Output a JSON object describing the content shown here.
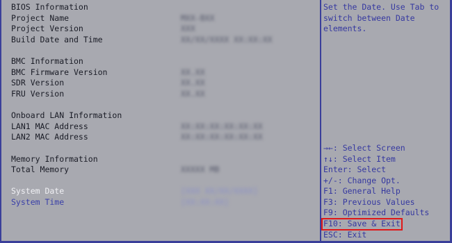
{
  "bios": {
    "section_title": "BIOS Information",
    "project_name_label": "Project Name",
    "project_name_value": "MXX-BXX",
    "project_version_label": "Project Version",
    "project_version_value": "XXX",
    "build_date_label": "Build Date and Time",
    "build_date_value": "XX/XX/XXXX XX:XX:XX"
  },
  "bmc": {
    "section_title": "BMC Information",
    "firmware_label": "BMC Firmware Version",
    "firmware_value": "XX.XX",
    "sdr_label": "SDR Version",
    "sdr_value": "XX.XX",
    "fru_label": "FRU Version",
    "fru_value": "XX.XX"
  },
  "lan": {
    "section_title": "Onboard LAN Information",
    "lan1_label": "LAN1 MAC Address",
    "lan1_value": "XX:XX:XX:XX:XX:XX",
    "lan2_label": "LAN2 MAC Address",
    "lan2_value": "XX:XX:XX:XX:XX:XX"
  },
  "memory": {
    "section_title": "Memory Information",
    "total_label": "Total Memory",
    "total_value": "XXXXX MB"
  },
  "system": {
    "date_label": "System Date",
    "date_value": "[XXX XX/XX/XXXX]",
    "time_label": "System Time",
    "time_value": "[XX:XX:XX]"
  },
  "help": {
    "text": "Set the Date. Use Tab to\nswitch between Date\nelements."
  },
  "hotkeys": [
    "→←: Select Screen",
    "↑↓: Select Item",
    "Enter: Select",
    "+/-: Change Opt.",
    "F1: General Help",
    "F3: Previous Values",
    "F9: Optimized Defaults",
    "F10: Save & Exit",
    "ESC: Exit"
  ],
  "colors": {
    "background": "#a8a9b0",
    "frame": "#3a3f9a",
    "help_text": "#3538a0",
    "highlight": "#e01818"
  }
}
